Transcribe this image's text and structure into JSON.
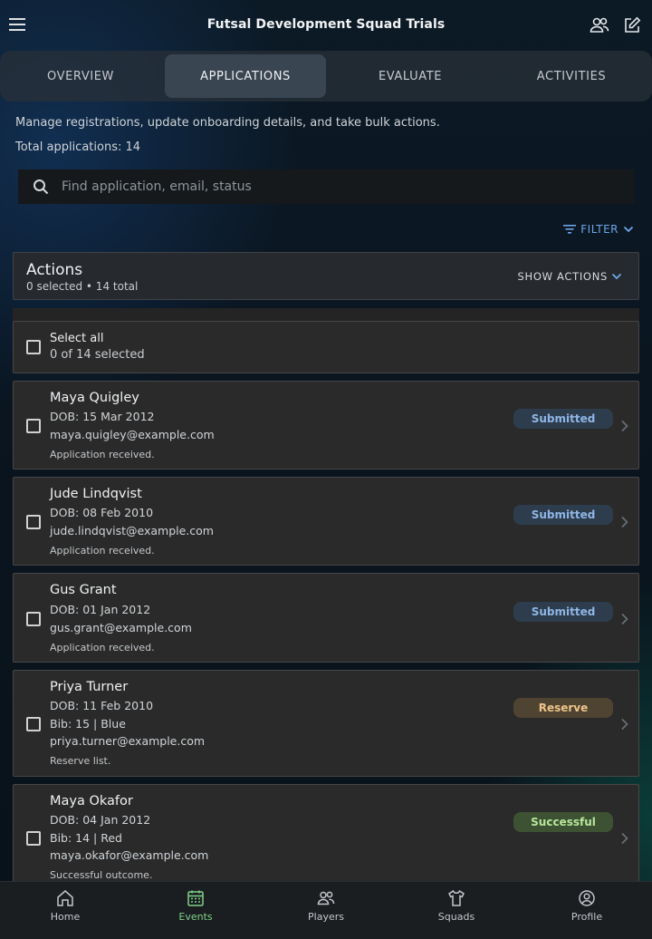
{
  "header": {
    "title": "Futsal Development Squad Trials"
  },
  "tabs": [
    {
      "label": "OVERVIEW",
      "active": false
    },
    {
      "label": "APPLICATIONS",
      "active": true
    },
    {
      "label": "EVALUATE",
      "active": false
    },
    {
      "label": "ACTIVITIES",
      "active": false
    }
  ],
  "intro": {
    "description": "Manage registrations, update onboarding details, and take bulk actions.",
    "total": "Total applications: 14"
  },
  "search": {
    "placeholder": "Find application, email, status",
    "value": ""
  },
  "filter": {
    "label": "FILTER"
  },
  "actions": {
    "title": "Actions",
    "subtitle": "0 selected • 14 total",
    "toggle_label": "SHOW ACTIONS"
  },
  "select_all": {
    "label": "Select all",
    "count": "0 of 14 selected"
  },
  "applications": [
    {
      "name": "Maya Quigley",
      "dob": "DOB: 15 Mar 2012",
      "bib": "",
      "email": "maya.quigley@example.com",
      "note": "Application received.",
      "status": "Submitted",
      "status_type": "submitted"
    },
    {
      "name": "Jude Lindqvist",
      "dob": "DOB: 08 Feb 2010",
      "bib": "",
      "email": "jude.lindqvist@example.com",
      "note": "Application received.",
      "status": "Submitted",
      "status_type": "submitted"
    },
    {
      "name": "Gus Grant",
      "dob": "DOB: 01 Jan 2012",
      "bib": "",
      "email": "gus.grant@example.com",
      "note": "Application received.",
      "status": "Submitted",
      "status_type": "submitted"
    },
    {
      "name": "Priya Turner",
      "dob": "DOB: 11 Feb 2010",
      "bib": "Bib: 15 | Blue",
      "email": "priya.turner@example.com",
      "note": "Reserve list.",
      "status": "Reserve",
      "status_type": "reserve"
    },
    {
      "name": "Maya Okafor",
      "dob": "DOB: 04 Jan 2012",
      "bib": "Bib: 14 | Red",
      "email": "maya.okafor@example.com",
      "note": "Successful outcome.",
      "status": "Successful",
      "status_type": "successful"
    }
  ],
  "bottom_nav": [
    {
      "label": "Home",
      "icon": "home-icon",
      "active": false
    },
    {
      "label": "Events",
      "icon": "calendar-icon",
      "active": true
    },
    {
      "label": "Players",
      "icon": "people-icon",
      "active": false
    },
    {
      "label": "Squads",
      "icon": "shirt-icon",
      "active": false
    },
    {
      "label": "Profile",
      "icon": "user-circle-icon",
      "active": false
    }
  ],
  "colors": {
    "accent_blue": "#6ea6ea",
    "nav_active": "#7ed28a",
    "submitted": "#8fb6e6",
    "reserve": "#eec58a",
    "successful": "#b8e69a"
  }
}
